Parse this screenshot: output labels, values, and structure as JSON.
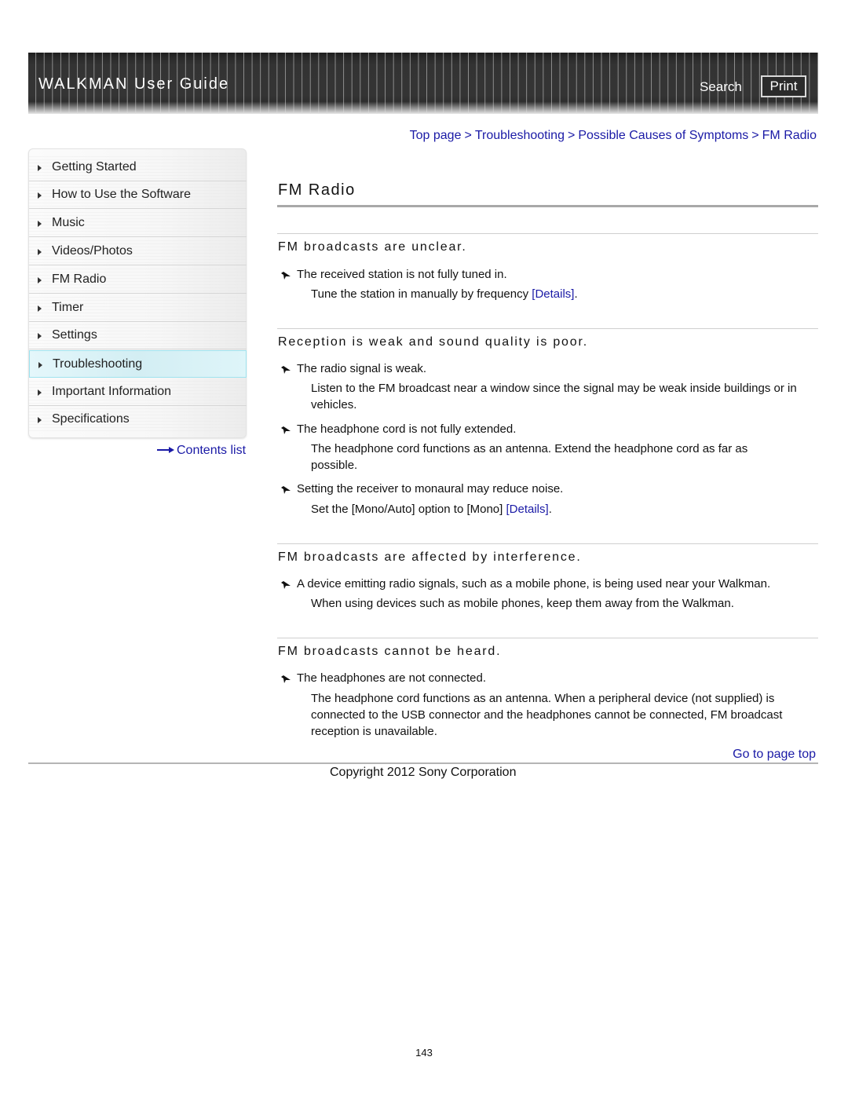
{
  "header": {
    "title": "WALKMAN User Guide",
    "search_label": "Search",
    "print_label": "Print"
  },
  "sidebar": {
    "items": [
      {
        "label": "Getting Started",
        "active": false
      },
      {
        "label": "How to Use the Software",
        "active": false
      },
      {
        "label": "Music",
        "active": false
      },
      {
        "label": "Videos/Photos",
        "active": false
      },
      {
        "label": "FM Radio",
        "active": false
      },
      {
        "label": "Timer",
        "active": false
      },
      {
        "label": "Settings",
        "active": false
      },
      {
        "label": "Troubleshooting",
        "active": true
      },
      {
        "label": "Important Information",
        "active": false
      },
      {
        "label": "Specifications",
        "active": false
      }
    ],
    "contents_link": "Contents list"
  },
  "breadcrumb": {
    "items": [
      "Top page",
      "Troubleshooting",
      "Possible Causes of Symptoms",
      "FM Radio"
    ],
    "separator": ">"
  },
  "main": {
    "title": "FM Radio",
    "sections": [
      {
        "heading": "FM broadcasts are unclear.",
        "entries": [
          {
            "cause": "The received station is not fully tuned in.",
            "remedy": "Tune the station in manually by frequency",
            "link": "[Details]",
            "suffix": "."
          }
        ]
      },
      {
        "heading": "Reception is weak and sound quality is poor.",
        "entries": [
          {
            "cause": "The radio signal is weak.",
            "remedy": "Listen to the FM broadcast near a window since the signal may be weak inside buildings or in vehicles."
          },
          {
            "cause": "The headphone cord is not fully extended.",
            "remedy": "The headphone cord functions as an antenna. Extend the headphone cord as far as possible."
          },
          {
            "cause": "Setting the receiver to monaural may reduce noise.",
            "remedy": "Set the [Mono/Auto] option to [Mono]",
            "link": "[Details]",
            "suffix": "."
          }
        ]
      },
      {
        "heading": "FM broadcasts are affected by interference.",
        "entries": [
          {
            "cause": "A device emitting radio signals, such as a mobile phone, is being used near your Walkman.",
            "remedy": "When using devices such as mobile phones, keep them away from the Walkman."
          }
        ]
      },
      {
        "heading": "FM broadcasts cannot be heard.",
        "entries": [
          {
            "cause": "The headphones are not connected.",
            "remedy": "The headphone cord functions as an antenna. When a peripheral device (not supplied) is connected to the USB connector and the headphones cannot be connected, FM broadcast reception is unavailable."
          }
        ]
      }
    ],
    "go_to_top": "Go to page top"
  },
  "footer": {
    "copyright": "Copyright 2012 Sony Corporation",
    "page_number": "143"
  },
  "colors": {
    "link": "#1a1aa6",
    "active_nav": "#d3eef3",
    "header_bg": "#333333"
  }
}
